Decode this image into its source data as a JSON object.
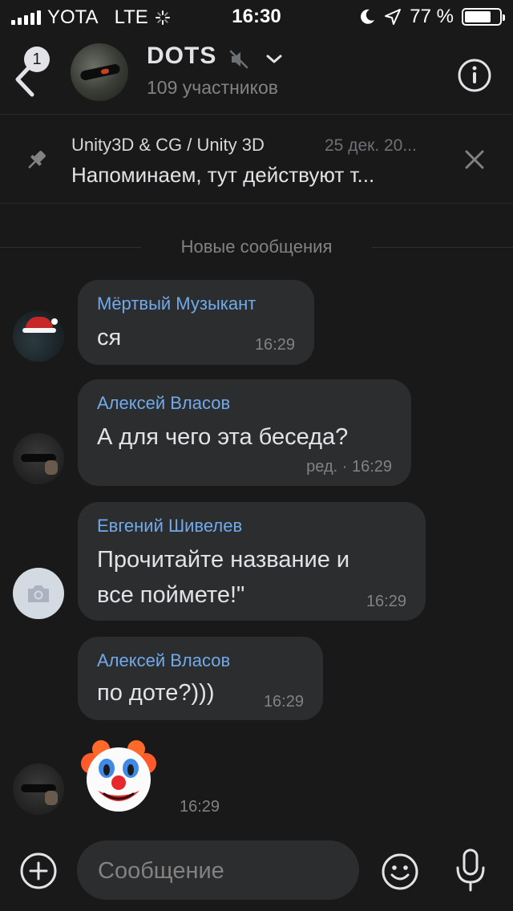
{
  "status_bar": {
    "carrier": "YOTA",
    "network": "LTE",
    "time": "16:30",
    "battery_percent": "77 %",
    "battery_level": 0.77
  },
  "header": {
    "back_badge": "1",
    "title": "DOTS",
    "subtitle": "109 участников",
    "icons": [
      "back-chevron-icon",
      "mute-icon",
      "chevron-down-icon",
      "info-icon"
    ]
  },
  "pinned": {
    "source": "Unity3D & CG / Unity 3D",
    "date": "25 дек. 20...",
    "text": "Напоминаем, тут действуют т..."
  },
  "divider": {
    "label": "Новые сообщения"
  },
  "messages": [
    {
      "sender": "Мёртвый Музыкант",
      "text": "ся",
      "time": "16:29"
    },
    {
      "sender": "Алексей Власов",
      "text": "А для чего эта беседа?",
      "time": "ред. · 16:29"
    },
    {
      "sender": "Евгений Шивелев",
      "lines": [
        "Прочитайте название и",
        "все поймете!\""
      ],
      "time": "16:29"
    },
    {
      "sender": "Алексей Власов",
      "text": "по доте?)))",
      "time": "16:29"
    },
    {
      "sticker": "clown-face",
      "time": "16:29"
    }
  ],
  "composer": {
    "placeholder": "Сообщение"
  },
  "colors": {
    "background": "#19191a",
    "bubble": "#2c2d2e",
    "sender_name": "#71aaeb",
    "text": "#e1e3e6",
    "secondary": "#828282"
  }
}
